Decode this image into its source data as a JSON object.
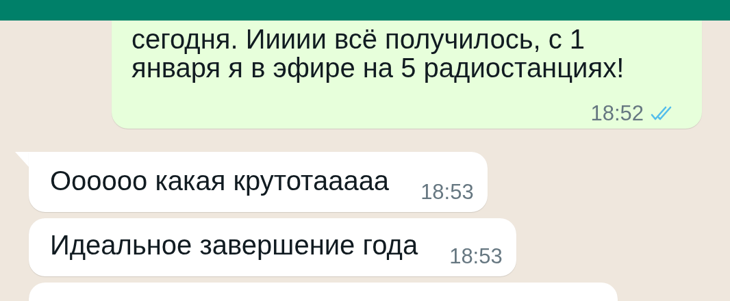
{
  "messages": [
    {
      "outgoing": true,
      "lines": [
        "сегодня. Иииии всё получилось, с 1",
        "января я в эфире на 5 радиостанциях!"
      ],
      "time": "18:52",
      "read": true,
      "tail": false
    },
    {
      "outgoing": false,
      "lines": [
        "Оооооо какая крутотааааа"
      ],
      "time": "18:53",
      "tail": true
    },
    {
      "outgoing": false,
      "lines": [
        "Идеальное завершение года"
      ],
      "time": "18:53",
      "tail": false
    },
    {
      "outgoing": false,
      "tail": false
    }
  ]
}
